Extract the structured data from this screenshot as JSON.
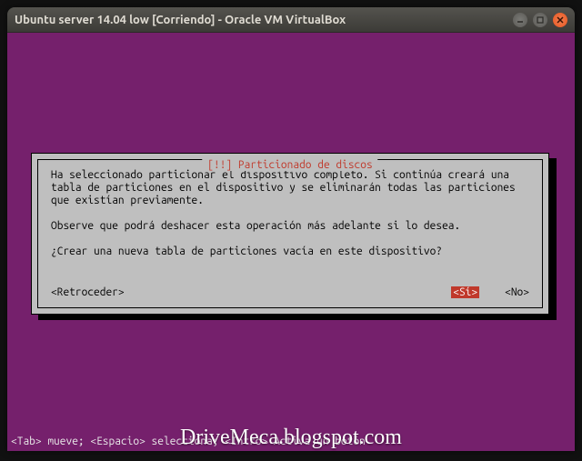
{
  "window": {
    "title": "Ubuntu server 14.04 low [Corriendo] - Oracle VM VirtualBox"
  },
  "dialog": {
    "title": "[!!] Particionado de discos",
    "p1": "Ha seleccionado particionar el dispositivo completo. Si continúa creará una tabla de particiones en el dispositivo y se eliminarán todas las particiones que existían previamente.",
    "p2": "Observe que podrá deshacer esta operación más adelante si lo desea.",
    "p3": "¿Crear una nueva tabla de particiones vacía en este dispositivo?",
    "back": "<Retroceder>",
    "yes": "<Sí>",
    "no": "<No>"
  },
  "hint": "<Tab> mueve; <Espacio> selecciona; <Intro> Activa un botón",
  "watermark": "DriveMeca.blogspot.com"
}
